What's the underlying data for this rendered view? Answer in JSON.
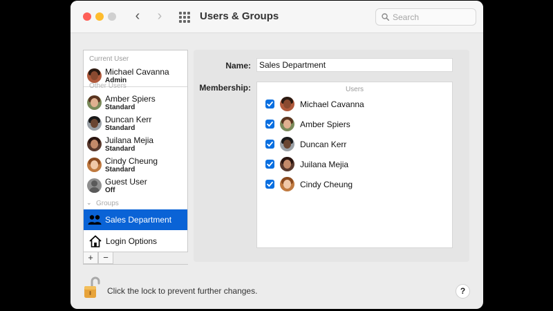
{
  "window": {
    "title": "Users & Groups",
    "search_placeholder": "Search"
  },
  "sidebar": {
    "current_user_header": "Current User",
    "current_user": {
      "name": "Michael Cavanna",
      "role": "Admin"
    },
    "other_users_header": "Other Users",
    "other_users": [
      {
        "name": "Amber Spiers",
        "role": "Standard"
      },
      {
        "name": "Duncan Kerr",
        "role": "Standard"
      },
      {
        "name": "Juilana Mejia",
        "role": "Standard"
      },
      {
        "name": "Cindy Cheung",
        "role": "Standard"
      },
      {
        "name": "Guest User",
        "role": "Off"
      }
    ],
    "groups_header": "Groups",
    "selected_group": "Sales Department",
    "login_options": "Login Options",
    "add_symbol": "+",
    "remove_symbol": "−"
  },
  "detail": {
    "name_label": "Name:",
    "name_value": "Sales Department",
    "membership_label": "Membership:",
    "column_header": "Users",
    "members": [
      {
        "name": "Michael Cavanna",
        "checked": true
      },
      {
        "name": "Amber Spiers",
        "checked": true
      },
      {
        "name": "Duncan Kerr",
        "checked": true
      },
      {
        "name": "Juilana Mejia",
        "checked": true
      },
      {
        "name": "Cindy Cheung",
        "checked": true
      }
    ]
  },
  "footer": {
    "lock_message": "Click the lock to prevent further changes.",
    "help_symbol": "?"
  },
  "colors": {
    "accent": "#0a63d6",
    "checkbox": "#0a6fe0",
    "close": "#fe5f57",
    "minimize": "#febc2e"
  }
}
